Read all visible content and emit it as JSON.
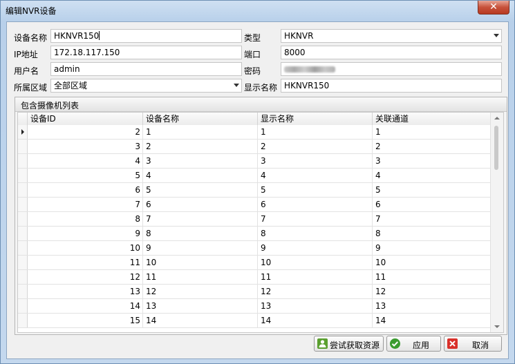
{
  "window": {
    "title": "编辑NVR设备",
    "close_glyph": "✕"
  },
  "form": {
    "device_name_label": "设备名称",
    "device_name_value": "HKNVR150",
    "type_label": "类型",
    "type_value": "HKNVR",
    "ip_label": "IP地址",
    "ip_value": "172.18.117.150",
    "port_label": "端口",
    "port_value": "8000",
    "user_label": "用户名",
    "user_value": "admin",
    "password_label": "密码",
    "area_label": "所属区域",
    "area_value": "全部区域",
    "display_name_label": "显示名称",
    "display_name_value": "HKNVR150"
  },
  "group": {
    "title": "包含摄像机列表",
    "columns": [
      "设备ID",
      "设备名称",
      "显示名称",
      "关联通道"
    ],
    "rows": [
      [
        "2",
        "1",
        "1",
        "1"
      ],
      [
        "3",
        "2",
        "2",
        "2"
      ],
      [
        "4",
        "3",
        "3",
        "3"
      ],
      [
        "5",
        "4",
        "4",
        "4"
      ],
      [
        "6",
        "5",
        "5",
        "5"
      ],
      [
        "7",
        "6",
        "6",
        "6"
      ],
      [
        "8",
        "7",
        "7",
        "7"
      ],
      [
        "9",
        "8",
        "8",
        "8"
      ],
      [
        "10",
        "9",
        "9",
        "9"
      ],
      [
        "11",
        "10",
        "10",
        "10"
      ],
      [
        "12",
        "11",
        "11",
        "11"
      ],
      [
        "13",
        "12",
        "12",
        "12"
      ],
      [
        "14",
        "13",
        "13",
        "13"
      ],
      [
        "15",
        "14",
        "14",
        "14"
      ]
    ]
  },
  "buttons": {
    "try_fetch": "尝试获取资源",
    "apply": "应用",
    "cancel": "取消"
  },
  "icons": {
    "try_fetch": "user-resource-icon",
    "apply": "check-icon",
    "cancel": "cross-icon"
  },
  "colors": {
    "apply_icon": "#3a9b2f",
    "cancel_icon": "#d9302a",
    "try_icon": "#5a9f2f"
  }
}
